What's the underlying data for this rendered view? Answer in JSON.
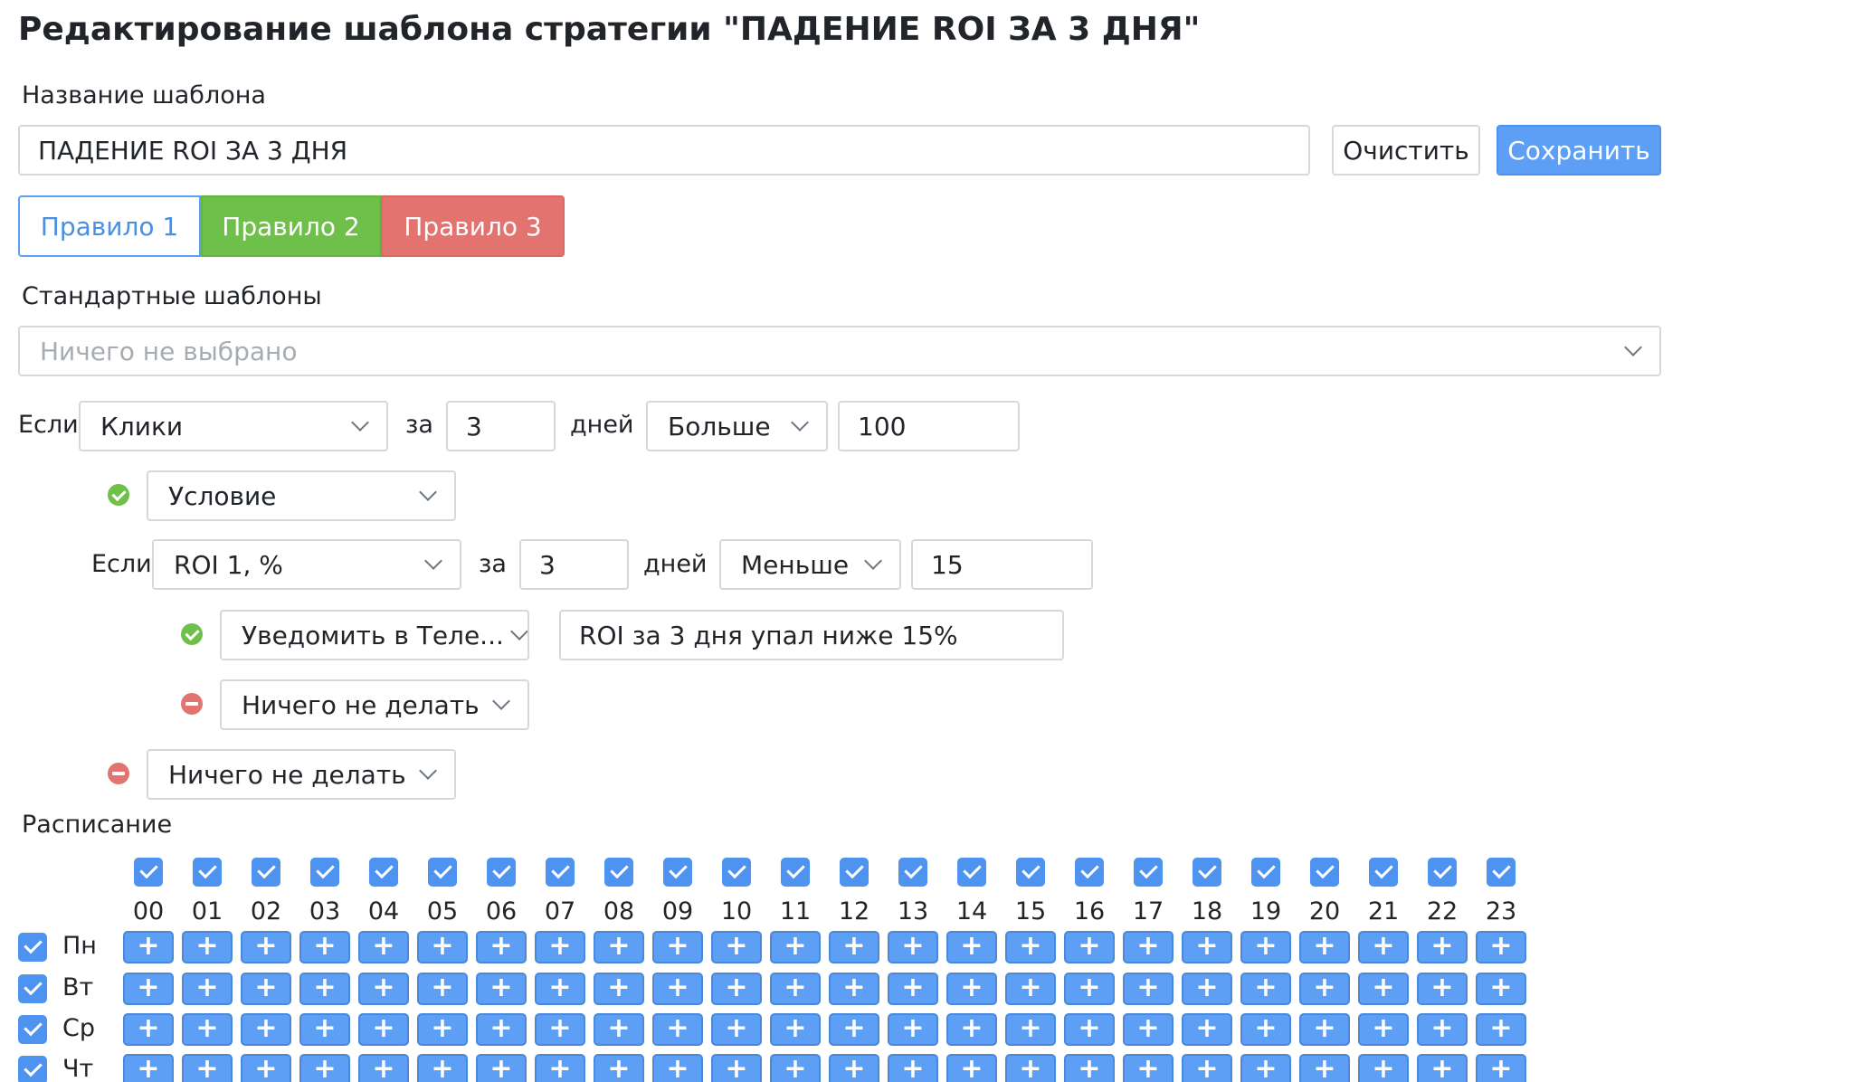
{
  "page": {
    "title": "Редактирование шаблона стратегии \"ПАДЕНИЕ ROI ЗА 3 ДНЯ\""
  },
  "template_name": {
    "label": "Название шаблона",
    "value": "ПАДЕНИЕ ROI ЗА 3 ДНЯ",
    "clear_button": "Очистить",
    "save_button": "Сохранить"
  },
  "rule_tabs": [
    {
      "label": "Правило 1",
      "color": "#5c9ff5"
    },
    {
      "label": "Правило 2",
      "color": "#6fbf4b"
    },
    {
      "label": "Правило 3",
      "color": "#e2736f"
    }
  ],
  "standard_templates": {
    "label": "Стандартные шаблоны",
    "placeholder": "Ничего не выбрано"
  },
  "rule": {
    "if_label": "Если",
    "for_label": "за",
    "days_label": "дней",
    "metric": "Клики",
    "days": "3",
    "comparison": "Больше",
    "threshold": "100",
    "then_action": "Условие",
    "nested": {
      "if_label": "Если",
      "for_label": "за",
      "days_label": "дней",
      "metric": "ROI 1, %",
      "days": "3",
      "comparison": "Меньше",
      "threshold": "15",
      "then_action": "Уведомить в Теле...",
      "then_message": "ROI за 3 дня упал ниже 15%",
      "else_action": "Ничего не делать"
    },
    "else_action": "Ничего не делать"
  },
  "schedule": {
    "label": "Расписание",
    "hours": [
      "00",
      "01",
      "02",
      "03",
      "04",
      "05",
      "06",
      "07",
      "08",
      "09",
      "10",
      "11",
      "12",
      "13",
      "14",
      "15",
      "16",
      "17",
      "18",
      "19",
      "20",
      "21",
      "22",
      "23"
    ],
    "days": [
      "Пн",
      "Вт",
      "Ср",
      "Чт"
    ],
    "cell_symbol": "+",
    "accent_color": "#5c9ff5"
  }
}
